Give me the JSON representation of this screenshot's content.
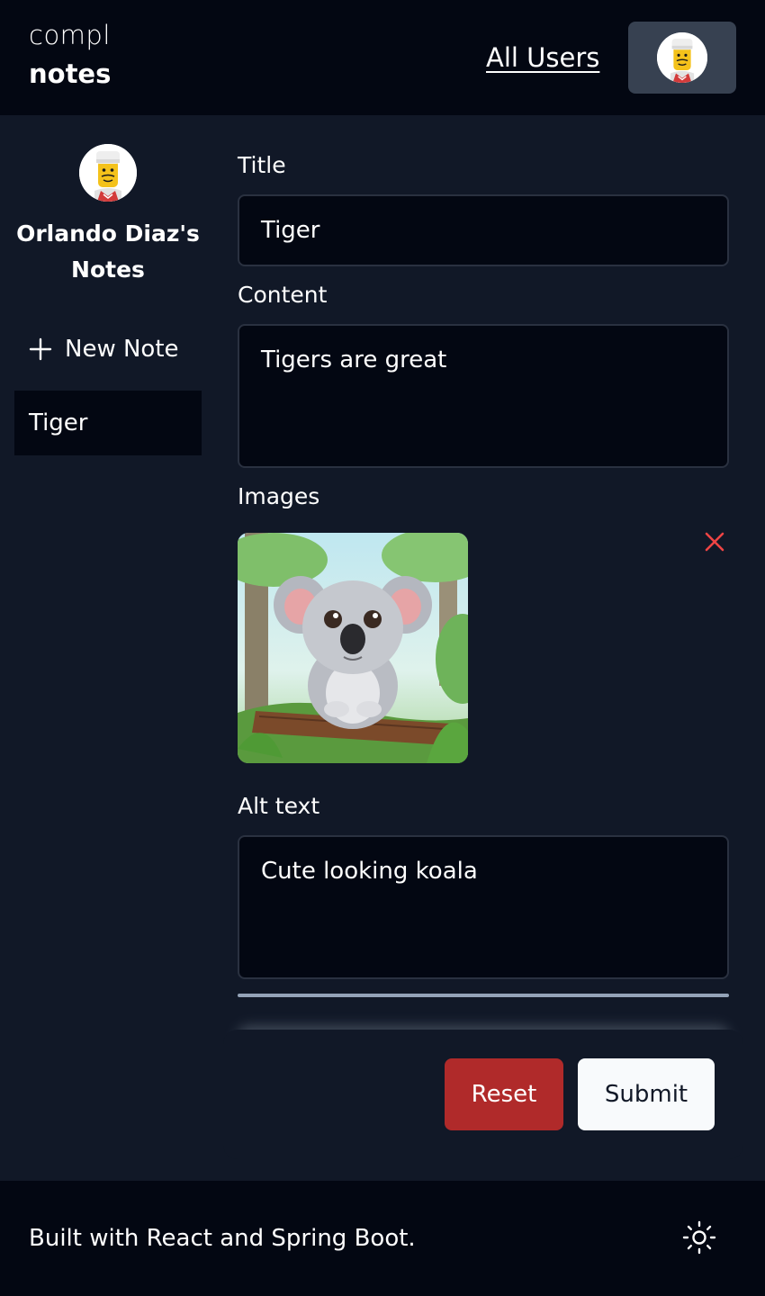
{
  "header": {
    "logo_top": "compl",
    "logo_bottom": "notes",
    "all_users_link": "All Users",
    "user_avatar_icon": "lego-minifigure-avatar"
  },
  "sidebar": {
    "owner_name": "Orlando Diaz's Notes",
    "new_note_label": "New Note",
    "notes": [
      {
        "title": "Tiger",
        "selected": true
      }
    ]
  },
  "form": {
    "title_label": "Title",
    "title_value": "Tiger",
    "content_label": "Content",
    "content_value": "Tigers are great",
    "images_label": "Images",
    "alt_text_label": "Alt text",
    "alt_text_value": "Cute looking koala",
    "remove_image_icon": "close-icon"
  },
  "actions": {
    "reset_label": "Reset",
    "submit_label": "Submit"
  },
  "footer": {
    "text": "Built with React and Spring Boot.",
    "theme_toggle_icon": "sun-icon"
  },
  "colors": {
    "background": "#111827",
    "header_footer": "#030712",
    "reset": "#b02a2a",
    "submit": "#f8fafc",
    "close_icon": "#ef4444"
  }
}
